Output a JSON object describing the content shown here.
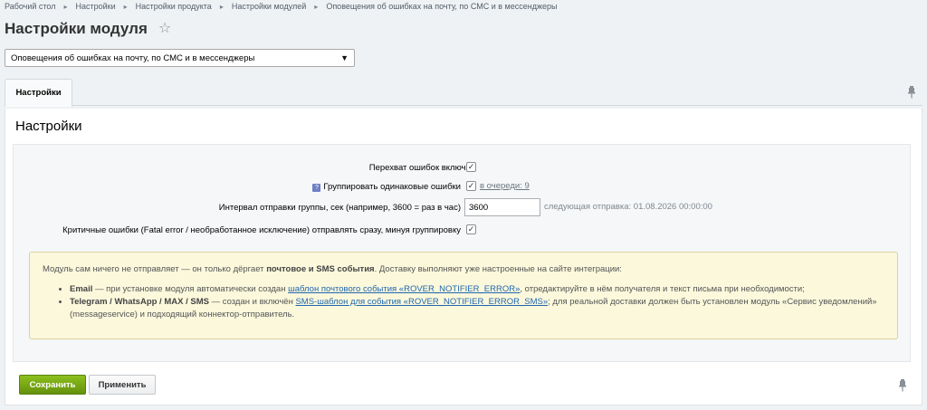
{
  "breadcrumbs": [
    "Рабочий стол",
    "Настройки",
    "Настройки продукта",
    "Настройки модулей",
    "Оповещения об ошибках на почту, по СМС и в мессенджеры"
  ],
  "page": {
    "title": "Настройки модуля"
  },
  "module_select": {
    "value": "Оповещения об ошибках на почту, по СМС и в мессенджеры"
  },
  "tabs": [
    {
      "label": "Настройки",
      "active": true
    }
  ],
  "section": {
    "title": "Настройки"
  },
  "form": {
    "intercept_label": "Перехват ошибок включён",
    "intercept_checked": true,
    "group_label": "Группировать одинаковые ошибки",
    "group_checked": true,
    "group_queue_link": "в очереди: 9",
    "interval_label": "Интервал отправки группы, сек (например, 3600 = раз в час)",
    "interval_value": "3600",
    "next_send_text": "следующая отправка: 01.08.2026 00:00:00",
    "fatal_label": "Критичные ошибки (Fatal error / необработанное исключение) отправлять сразу, минуя группировку",
    "fatal_checked": true
  },
  "note": {
    "intro_before": "Модуль сам ничего не отправляет — он только дёргает ",
    "intro_bold": "почтовое и SMS события",
    "intro_after": ". Доставку выполняют уже настроенные на сайте интеграции:",
    "email_bold": "Email",
    "email_before": " — при установке модуля автоматически создан ",
    "email_link": "шаблон почтового события «ROVER_NOTIFIER_ERROR»",
    "email_after": ", отредактируйте в нём получателя и текст письма при необходимости;",
    "sms_bold": "Telegram / WhatsApp / MAX / SMS",
    "sms_before": " — создан и включён ",
    "sms_link": "SMS-шаблон для события «ROVER_NOTIFIER_ERROR_SMS»",
    "sms_after": "; для реальной доставки должен быть установлен модуль «Сервис уведомлений» (messageservice) и подходящий коннектор-отправитель."
  },
  "buttons": {
    "save": "Сохранить",
    "apply": "Применить"
  },
  "icons": [
    "chevron-right-icon",
    "star-icon",
    "chevron-down-icon",
    "pin-icon",
    "check-icon",
    "hint-icon"
  ],
  "colors": {
    "save_button": "#6e9a12",
    "link": "#2067b0",
    "note_bg": "#fbf8dc"
  }
}
